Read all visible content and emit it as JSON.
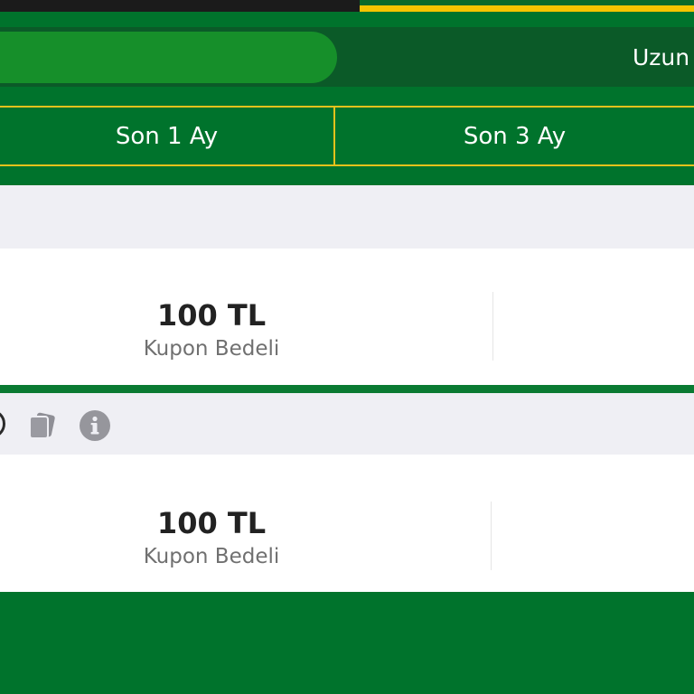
{
  "tabs": {
    "right_label": "Uzun"
  },
  "filters": [
    {
      "label": "Son 1 Ay"
    },
    {
      "label": "Son 3 Ay"
    }
  ],
  "coupons": [
    {
      "amount": "100 TL",
      "label": "Kupon Bedeli"
    },
    {
      "amount": "100 TL",
      "label": "Kupon Bedeli"
    }
  ],
  "icons": {
    "clock": "clock-icon",
    "copy": "copy-icon",
    "info": "info-icon"
  },
  "colors": {
    "primary_green": "#00732c",
    "active_segment": "#168f2a",
    "accent_yellow": "#f5c400",
    "light_gray": "#efeff4"
  }
}
